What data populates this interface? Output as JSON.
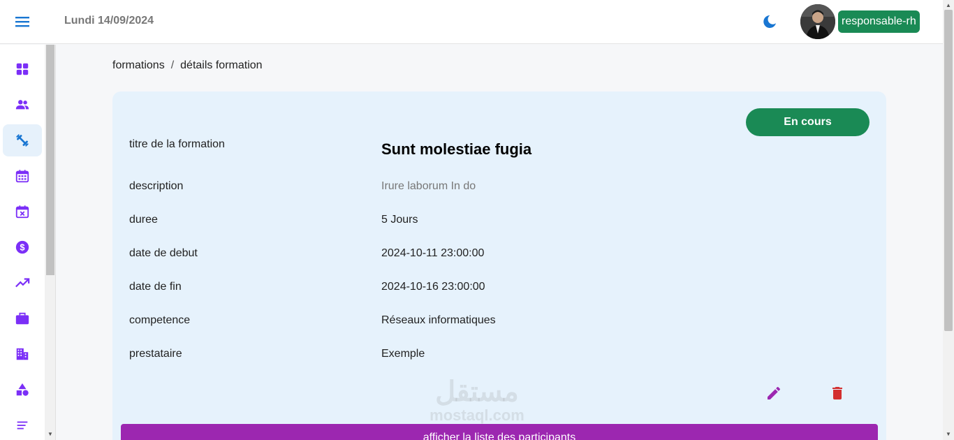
{
  "header": {
    "date": "Lundi 14/09/2024",
    "role": "responsable-rh"
  },
  "sidebar": {
    "items": [
      {
        "icon": "dashboard-icon"
      },
      {
        "icon": "people-icon"
      },
      {
        "icon": "training-icon",
        "active": true
      },
      {
        "icon": "calendar-icon"
      },
      {
        "icon": "calendar-cancel-icon"
      },
      {
        "icon": "dollar-icon"
      },
      {
        "icon": "trending-up-icon"
      },
      {
        "icon": "briefcase-icon"
      },
      {
        "icon": "building-icon"
      },
      {
        "icon": "shapes-icon"
      },
      {
        "icon": "list-icon"
      }
    ]
  },
  "breadcrumb": {
    "parent": "formations",
    "separator": "/",
    "current": "détails formation"
  },
  "formation": {
    "status": "En cours",
    "fields": [
      {
        "label": "titre de la formation",
        "value": "Sunt molestiae fugia"
      },
      {
        "label": "description",
        "value": "Irure laborum In do"
      },
      {
        "label": "duree",
        "value": "5 Jours"
      },
      {
        "label": "date de debut",
        "value": "2024-10-11 23:00:00"
      },
      {
        "label": "date de fin",
        "value": "2024-10-16 23:00:00"
      },
      {
        "label": "competence",
        "value": "Réseaux informatiques"
      },
      {
        "label": "prestataire",
        "value": "Exemple"
      }
    ],
    "participants_button": "afficher la liste des participants"
  },
  "watermark": {
    "arabic": "مستقل",
    "latin": "mostaql.com"
  },
  "colors": {
    "accent_blue": "#1976d2",
    "sidebar_icon": "#7b2ff7",
    "status_green": "#1a8a55",
    "button_purple": "#9c27b0",
    "edit_purple": "#9c27b0",
    "delete_red": "#d32f2f",
    "card_bg": "#e6f2fc"
  }
}
